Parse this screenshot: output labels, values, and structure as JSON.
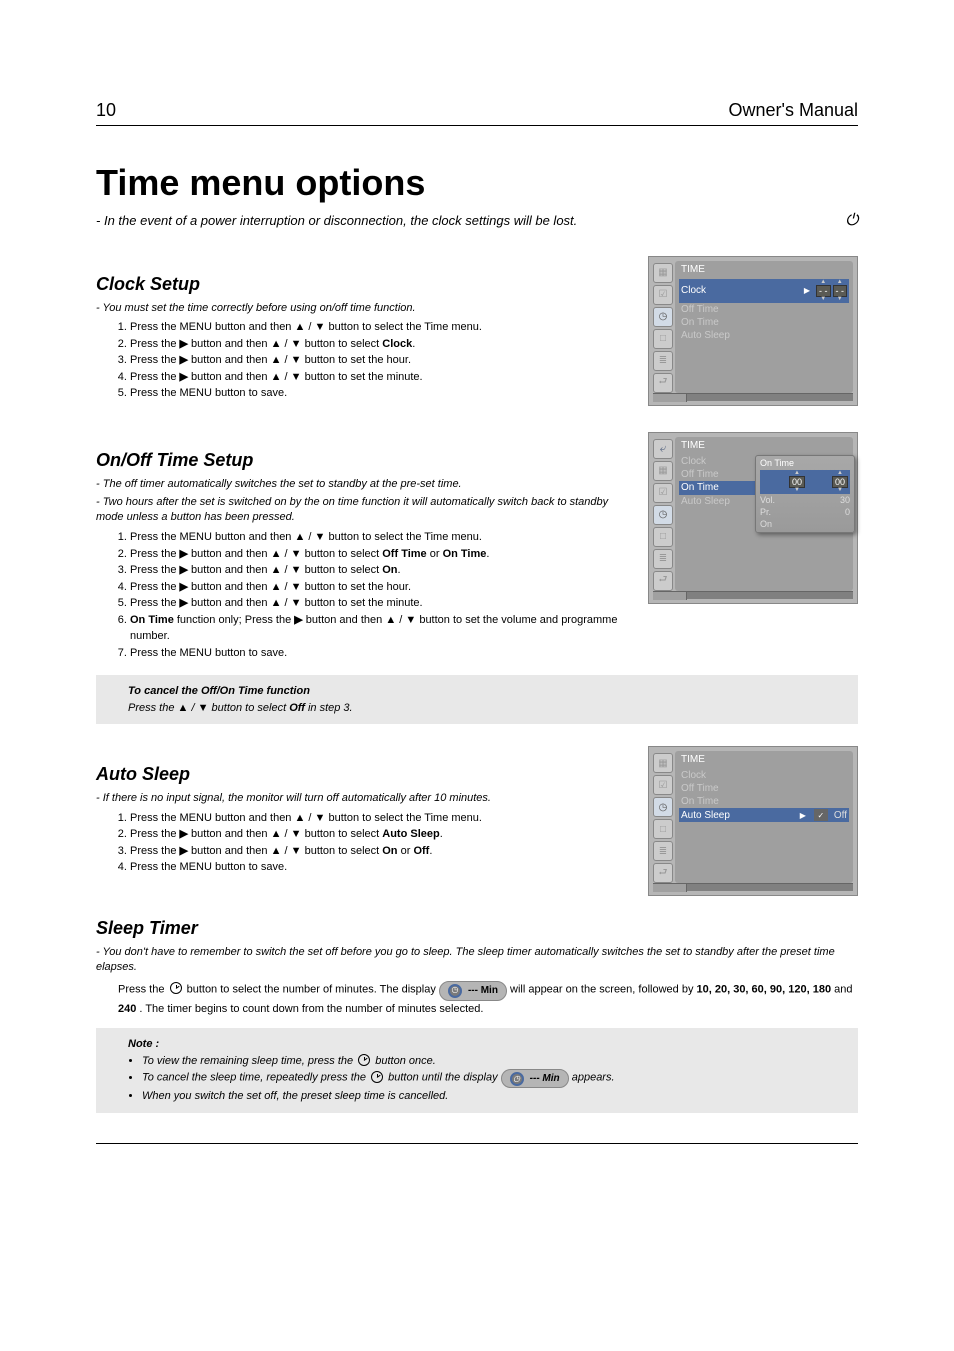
{
  "header": {
    "page_number": "10",
    "book_title": "Owner's Manual"
  },
  "main": {
    "heading": "Time menu options",
    "lead_note": "In the event of a power interruption or disconnection, the clock settings will be lost.",
    "clock": {
      "title": "Clock Setup",
      "note": "You must set the time correctly before using on/off time function.",
      "steps": [
        {
          "text": "Press the MENU button and then <b>▲</b> / <b>▼</b> button to select the Time menu."
        },
        {
          "text": "Press the <b>▶</b> button and then <b>▲</b> / <b>▼</b> button to select <b>Clock</b>."
        },
        {
          "text": "Press the <b>▶</b> button and then <b>▲</b> / <b>▼</b> button to set the hour."
        },
        {
          "text": "Press the <b>▶</b> button and then <b>▲</b> / <b>▼</b> button to set the minute."
        },
        {
          "text": "Press the MENU button to save."
        }
      ],
      "osd": {
        "title": "TIME",
        "rows": [
          {
            "label": "Clock",
            "hl": true,
            "spin": [
              "- -",
              "- -"
            ]
          },
          {
            "label": "Off Time"
          },
          {
            "label": "On Time"
          },
          {
            "label": "Auto Sleep"
          }
        ]
      }
    },
    "onoff": {
      "title": "On/Off Time Setup",
      "note1": "The off timer automatically switches the set to standby at the pre-set time.",
      "note2": "Two hours after the set is switched on by the on time function it will automatically switch back to standby mode unless a button has been pressed.",
      "steps": [
        {
          "text": "Press the MENU button and then <b>▲</b> / <b>▼</b> button to select the Time menu."
        },
        {
          "text": "Press the <b>▶</b> button and then <b>▲</b> / <b>▼</b> button to select <b>Off Time</b> or <b>On Time</b>."
        },
        {
          "text": "Press the <b>▶</b> button and then <b>▲</b> / <b>▼</b> button to select <b>On</b>."
        },
        {
          "text": "Press the <b>▶</b> button and then <b>▲</b> / <b>▼</b> button to set the hour."
        },
        {
          "text": "Press the <b>▶</b> button and then <b>▲</b> / <b>▼</b> button to set the minute."
        },
        {
          "text": "<b>On Time</b> function only; Press the <b>▶</b> button and then <b>▲</b> / <b>▼</b> button to set the volume and programme number."
        },
        {
          "text": "Press the MENU button to save."
        }
      ],
      "cancel": {
        "head": "To cancel the Off/On Time function",
        "body": "Press the ▲ / ▼ button to select Off in step 3."
      },
      "osd": {
        "title": "TIME",
        "rows": [
          {
            "label": "Clock"
          },
          {
            "label": "Off Time"
          },
          {
            "label": "On Time",
            "hl": true
          },
          {
            "label": "Auto Sleep"
          }
        ],
        "popup": {
          "title": "On Time",
          "rows": [
            {
              "label": "",
              "hl": true,
              "spin": [
                "00",
                "00"
              ]
            },
            {
              "label": "Vol.",
              "value": "30"
            },
            {
              "label": "Pr.",
              "value": "0"
            },
            {
              "label": "On",
              "value": ""
            }
          ]
        }
      }
    },
    "autosleep": {
      "title": "Auto Sleep",
      "note": "If there is no input signal, the monitor will turn off automatically after 10 minutes.",
      "steps": [
        {
          "text": "Press the MENU button and then <b>▲</b> / <b>▼</b> button to select the Time menu."
        },
        {
          "text": "Press the <b>▶</b> button and then <b>▲</b> / <b>▼</b> button to select <b>Auto Sleep</b>."
        },
        {
          "text": "Press the <b>▶</b> button and then <b>▲</b> / <b>▼</b> button to select <b>On</b> or <b>Off</b>."
        },
        {
          "text": "Press the MENU button to save."
        }
      ],
      "osd": {
        "title": "TIME",
        "rows": [
          {
            "label": "Clock"
          },
          {
            "label": "Off Time"
          },
          {
            "label": "On Time"
          },
          {
            "label": "Auto Sleep",
            "hl": true,
            "value": "Off"
          }
        ]
      }
    },
    "sleepTimer": {
      "title": "Sleep Timer",
      "note": "You don't have to remember to switch the set off before you go to sleep. The sleep timer automatically switches the set to standby after the preset time elapses.",
      "body_parts": {
        "p1a": "Press the ",
        "p1b": " button to select the number of minutes. The display ",
        "p1c": " will appear on the screen, followed by ",
        "p1d": " and ",
        "p1e": ". The timer begins to count down from the number of minutes selected.",
        "pill": "--- Min",
        "mins": "10, 20, 30, 60, 90, 120, 180",
        "last": "240"
      },
      "notes": {
        "n1a": "To view the remaining sleep time, press the ",
        "n1b": " button once.",
        "n2a": "To cancel the sleep time, repeatedly press the ",
        "n2b": " button until the display ",
        "n2c": " appears.",
        "n3": "When you switch the set off, the preset sleep time is cancelled."
      }
    }
  },
  "icons": {
    "picture": "▦",
    "clock": "◷",
    "lamp": "☑",
    "screen": "□",
    "eq": "≣",
    "ret": "⮐",
    "shield": "⎋"
  }
}
